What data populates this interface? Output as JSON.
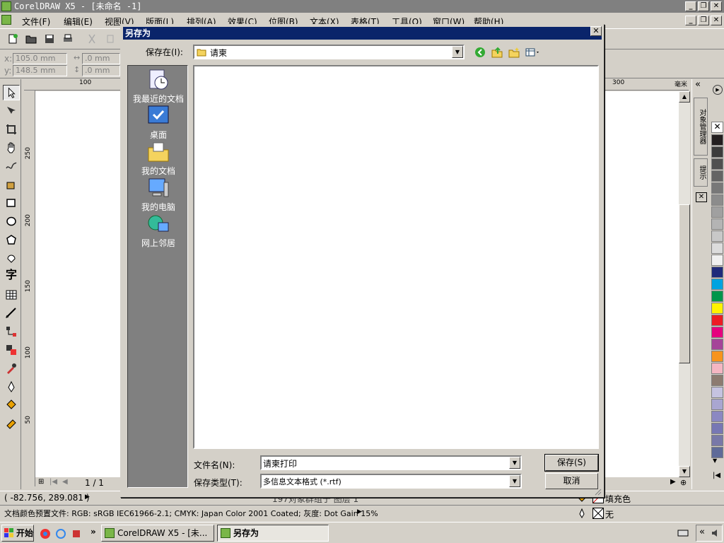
{
  "app": {
    "title": "CorelDRAW X5 - [未命名 -1]",
    "window_buttons": [
      "_",
      "❐",
      "✕"
    ]
  },
  "menu": [
    "文件(F)",
    "编辑(E)",
    "视图(V)",
    "版面(L)",
    "排列(A)",
    "效果(C)",
    "位图(B)",
    "文本(X)",
    "表格(T)",
    "工具(O)",
    "窗口(W)",
    "帮助(H)"
  ],
  "propbar": {
    "x_label": "x:",
    "x_value": "105.0 mm",
    "y_label": "y:",
    "y_value": "148.5 mm",
    "w_value": ".0 mm",
    "h_value": ".0 mm"
  },
  "ruler": {
    "h_labels": [
      "100",
      "300"
    ],
    "h_unit": "毫米",
    "v_labels": [
      "250",
      "200",
      "150",
      "100",
      "50"
    ]
  },
  "tools": {
    "text_tool": "字"
  },
  "docker": {
    "tabs": [
      "对象管理器",
      "提示"
    ]
  },
  "palette": [
    "#231f20",
    "#3c3c3c",
    "#505050",
    "#646464",
    "#787878",
    "#8c8c8c",
    "#a0a0a0",
    "#b4b4b4",
    "#c8c8c8",
    "#dcdcdc",
    "#f0f0f0",
    "#1f2a7a",
    "#00a3e0",
    "#00964b",
    "#fff200",
    "#ed1c24",
    "#e6007e",
    "#a54499",
    "#f7941d",
    "#f4b6c2",
    "#8c7b70",
    "#c5c3e0",
    "#a9a6d1",
    "#8b88c2",
    "#7777b4",
    "#7878a8",
    "#5f6b99"
  ],
  "page_nav": {
    "page": "1 / 1"
  },
  "status": {
    "coords": "( -82.756, 289.081 )",
    "layer_info": "197对象群组于 图层 1",
    "fill_label": "填充色",
    "outline_label": "无",
    "color_profile": "文档颜色预置文件: RGB: sRGB IEC61966-2.1; CMYK: Japan Color 2001 Coated; 灰度: Dot Gain 15%"
  },
  "taskbar": {
    "start": "开始",
    "tasks": [
      "CorelDRAW X5 - [未...",
      "另存为"
    ],
    "more": "»"
  },
  "dialog": {
    "title": "另存为",
    "save_in_label": "保存在(I):",
    "save_in_value": "请柬",
    "places": [
      "我最近的文档",
      "桌面",
      "我的文档",
      "我的电脑",
      "网上邻居"
    ],
    "filename_label": "文件名(N):",
    "filename_value": "请柬打印",
    "filetype_label": "保存类型(T):",
    "filetype_value": "多信息文本格式 (*.rtf)",
    "save_button": "保存(S)",
    "cancel_button": "取消"
  }
}
